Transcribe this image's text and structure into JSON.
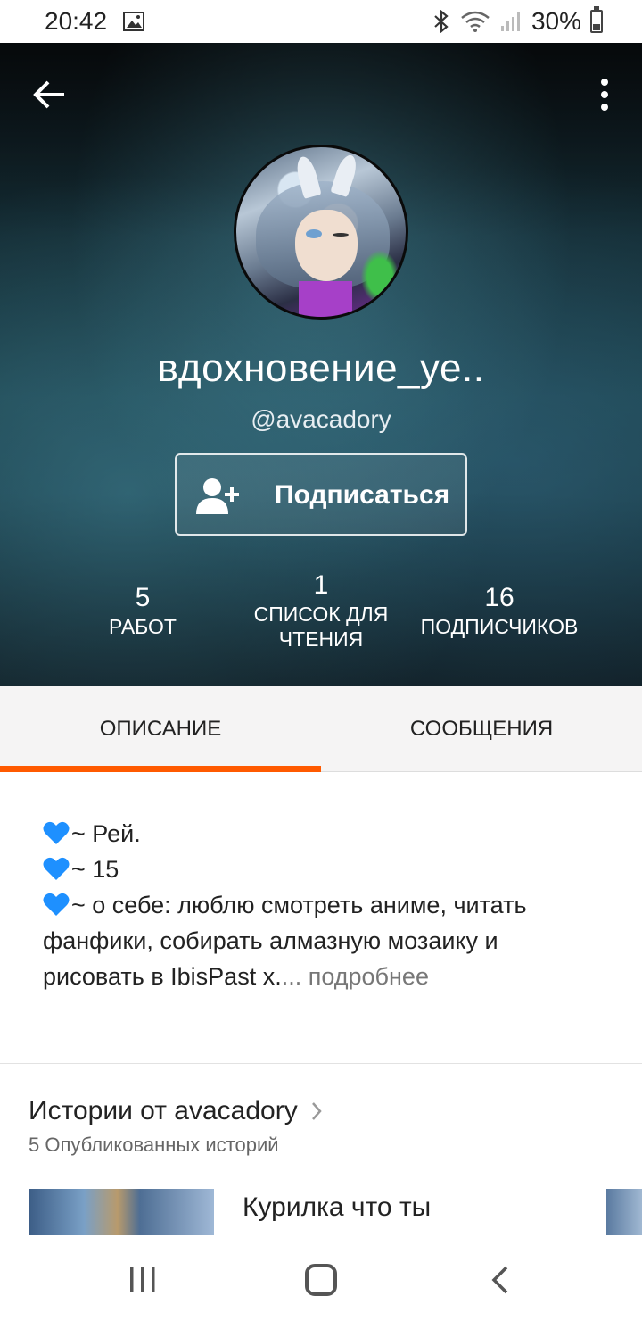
{
  "status_bar": {
    "time": "20:42",
    "battery": "30%",
    "icons": [
      "image-icon",
      "bluetooth-icon",
      "wifi-icon",
      "signal-icon",
      "battery-icon"
    ]
  },
  "header": {
    "back_icon": "arrow-left-icon",
    "more_icon": "more-vertical-icon",
    "display_name": "вдохновение_уе..",
    "username": "@avacadory",
    "follow_button": {
      "icon": "add-user-icon",
      "label": "Подписаться"
    },
    "stats": {
      "works": {
        "value": "5",
        "label": "РАБОТ"
      },
      "reading_lists": {
        "value": "1",
        "label_line1": "СПИСОК ДЛЯ",
        "label_line2": "ЧТЕНИЯ"
      },
      "followers": {
        "value": "16",
        "label": "ПОДПИСЧИКОВ"
      }
    }
  },
  "tabs": {
    "description": "ОПИСАНИЕ",
    "messages": "СООБЩЕНИЯ",
    "active": "description",
    "accent_color": "#ff5a00"
  },
  "about": {
    "line1": "~ Рей.",
    "line2": "~ 15",
    "line3": "~ о себе: люблю смотреть аниме, читать",
    "line4": "фанфики, собирать алмазную мозаику и",
    "line5": "рисовать в IbisPast x.",
    "more_link": "... подробнее",
    "heart_color": "#1e90ff"
  },
  "stories": {
    "title": "Истории от avacadory",
    "subtitle": "5 Опубликованных историй",
    "first_story_title": "Курилка что ты"
  },
  "nav_bar": {
    "icons": [
      "recents-icon",
      "home-icon",
      "back-icon"
    ]
  }
}
